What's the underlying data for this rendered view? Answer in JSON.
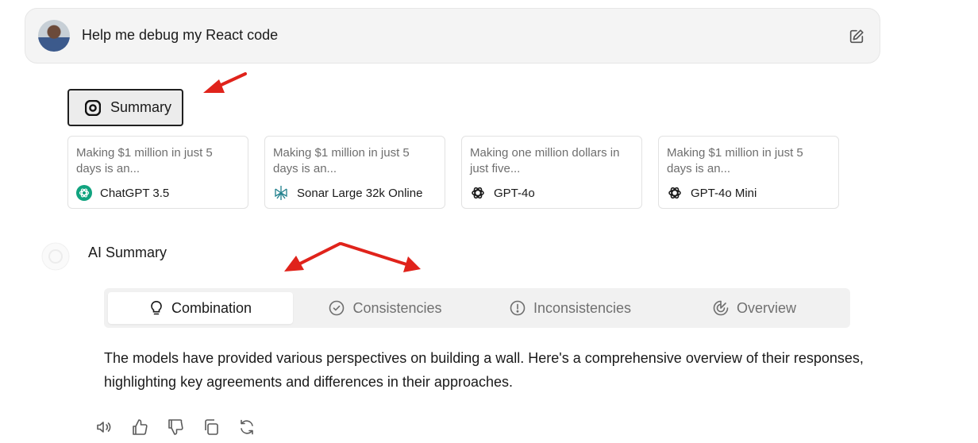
{
  "prompt": {
    "text": "Help me debug my React code"
  },
  "summary_button": {
    "label": "Summary"
  },
  "cards": [
    {
      "snippet": "Making $1 million in just 5 days is an...",
      "model": "ChatGPT 3.5",
      "icon": "chatgpt-icon"
    },
    {
      "snippet": "Making $1 million in just 5 days is an...",
      "model": "Sonar Large 32k Online",
      "icon": "perplexity-icon"
    },
    {
      "snippet": "Making one million dollars in just five...",
      "model": "GPT-4o",
      "icon": "openai-icon"
    },
    {
      "snippet": "Making $1 million in just 5 days is an...",
      "model": "GPT-4o Mini",
      "icon": "openai-icon"
    }
  ],
  "ai_summary": {
    "label": "AI Summary"
  },
  "tabs": [
    {
      "label": "Combination",
      "icon": "lightbulb-icon",
      "active": true
    },
    {
      "label": "Consistencies",
      "icon": "check-circle-icon"
    },
    {
      "label": "Inconsistencies",
      "icon": "alert-circle-icon"
    },
    {
      "label": "Overview",
      "icon": "chart-icon"
    }
  ],
  "body": {
    "text": "The models have provided various perspectives on building a wall. Here's a comprehensive overview of their responses, highlighting key agreements and differences in their approaches."
  },
  "colors": {
    "annotation_arrow": "#e0231b",
    "chatgpt_green": "#10a37f",
    "perplexity_teal": "#20808d"
  }
}
